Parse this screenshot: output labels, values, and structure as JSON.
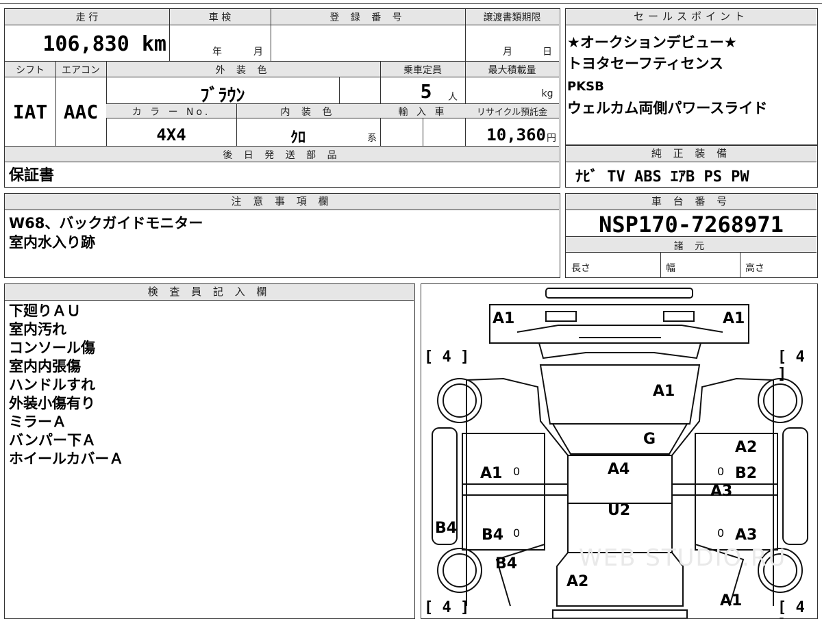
{
  "mileage": {
    "label": "走 行",
    "value": "106,830 km"
  },
  "inspection": {
    "label": "車 検",
    "year_unit": "年",
    "month_unit": "月"
  },
  "registration": {
    "label": "登 録 番 号",
    "value": ""
  },
  "transfer_deadline": {
    "label": "譲渡書類期限",
    "month_unit": "月",
    "day_unit": "日"
  },
  "shift": {
    "label": "シフト",
    "value": "IAT"
  },
  "aircon": {
    "label": "エアコン",
    "value": "AAC"
  },
  "exterior_color": {
    "label": "外 装 色",
    "value": "ﾌﾞﾗｳﾝ"
  },
  "capacity": {
    "label": "乗車定員",
    "value": "5",
    "unit": "人"
  },
  "max_load": {
    "label": "最大積載量",
    "unit": "kg"
  },
  "color_no": {
    "label": "カ ラ ー No.",
    "value": "4X4"
  },
  "interior_color": {
    "label": "内 装 色",
    "value": "ｸﾛ",
    "suffix": "系"
  },
  "import": {
    "label": "輸 入 車"
  },
  "recycle": {
    "label": "リサイクル預託金",
    "value": "10,360",
    "unit": "円"
  },
  "later_parts": {
    "label": "後 日 発 送 部 品",
    "value": "保証書"
  },
  "sales_points": {
    "label": "セールスポイント",
    "lines": [
      "★オークションデビュー★",
      "トヨタセーフティセンス",
      "PKSB",
      "ウェルカム両側パワースライド"
    ]
  },
  "equipment": {
    "label": "純 正 装 備",
    "value": "ﾅﾋﾞ TV ABS ｴｱB PS PW"
  },
  "notes": {
    "label": "注 意 事 項 欄",
    "lines": [
      "W68、バックガイドモニター",
      "室内水入り跡"
    ]
  },
  "chassis": {
    "label": "車 台 番 号",
    "value": "NSP170-7268971"
  },
  "specs": {
    "label": "諸 元",
    "length": "長さ",
    "width": "幅",
    "height": "高さ"
  },
  "inspector": {
    "label": "検 査 員 記 入 欄",
    "lines": [
      "下廻りＡＵ",
      "室内汚れ",
      "コンソール傷",
      "室内内張傷",
      "ハンドルすれ",
      "外装小傷有り",
      "ミラーＡ",
      "バンパー下Ａ",
      "ホイールカバーＡ"
    ]
  },
  "diagram": {
    "marks": {
      "front_left": "A1",
      "front_right": "A1",
      "hood": "A1",
      "windshield": "G",
      "roof": "A4",
      "roof_rear": "U2",
      "left_front_door": "A1",
      "left_rear_door": "B4",
      "left_rear_panel": "B4",
      "left_rear_side": "B4",
      "right_front_door": "A2",
      "right_front_door2": "B2",
      "right_center": "A3",
      "right_rear_door": "A3",
      "rear": "A2",
      "rear_right": "A1"
    },
    "zero": "0",
    "tires": [
      "4",
      "4",
      "4",
      "4"
    ],
    "watermark": "WEB STUDIO.RU"
  }
}
